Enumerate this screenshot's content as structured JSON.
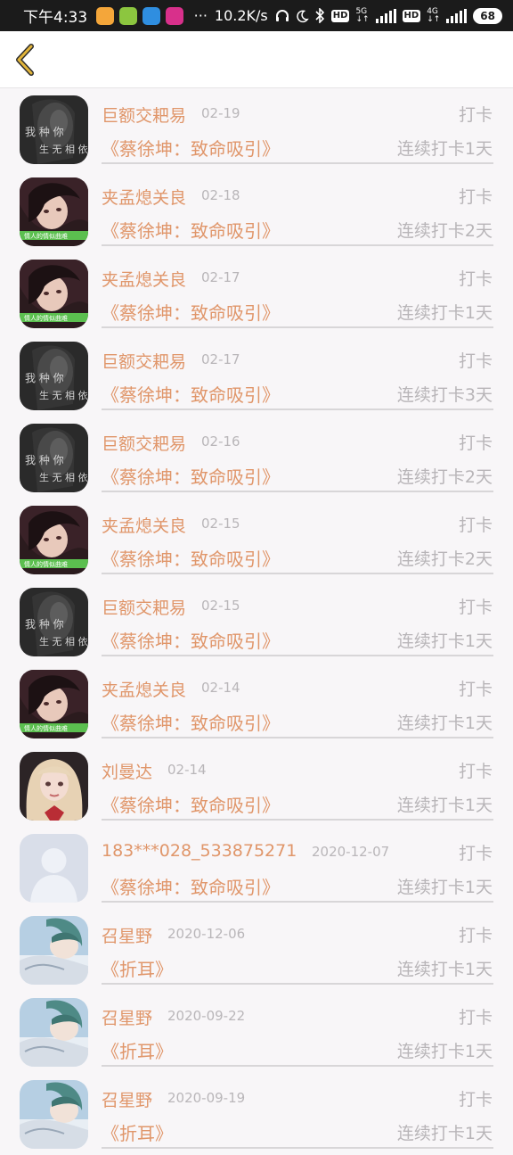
{
  "status_bar": {
    "time": "下午4:33",
    "more": "···",
    "speed": "10.2K/s",
    "hd1": "HD",
    "net1_top": "5G",
    "net1_bottom": "↓↑",
    "hd2": "HD",
    "net2_top": "4G",
    "net2_bottom": "↓↑",
    "battery": "68"
  },
  "nav": {
    "back_icon": "chevron-left-icon",
    "back_color": "#e2b53b"
  },
  "colors": {
    "accent": "#e0966a",
    "muted": "#b8b5b8"
  },
  "items": [
    {
      "name": "巨额交耙易",
      "date": "02-19",
      "action": "打卡",
      "book": "《蔡徐坤：致命吸引》",
      "streak": "连续打卡1天",
      "avatar": "dark-text-portrait"
    },
    {
      "name": "夹孟熄关良",
      "date": "02-18",
      "action": "打卡",
      "book": "《蔡徐坤：致命吸引》",
      "streak": "连续打卡2天",
      "avatar": "girl-portrait"
    },
    {
      "name": "夹孟熄关良",
      "date": "02-17",
      "action": "打卡",
      "book": "《蔡徐坤：致命吸引》",
      "streak": "连续打卡1天",
      "avatar": "girl-portrait"
    },
    {
      "name": "巨额交耙易",
      "date": "02-17",
      "action": "打卡",
      "book": "《蔡徐坤：致命吸引》",
      "streak": "连续打卡3天",
      "avatar": "dark-text-portrait"
    },
    {
      "name": "巨额交耙易",
      "date": "02-16",
      "action": "打卡",
      "book": "《蔡徐坤：致命吸引》",
      "streak": "连续打卡2天",
      "avatar": "dark-text-portrait"
    },
    {
      "name": "夹孟熄关良",
      "date": "02-15",
      "action": "打卡",
      "book": "《蔡徐坤：致命吸引》",
      "streak": "连续打卡2天",
      "avatar": "girl-portrait"
    },
    {
      "name": "巨额交耙易",
      "date": "02-15",
      "action": "打卡",
      "book": "《蔡徐坤：致命吸引》",
      "streak": "连续打卡1天",
      "avatar": "dark-text-portrait"
    },
    {
      "name": "夹孟熄关良",
      "date": "02-14",
      "action": "打卡",
      "book": "《蔡徐坤：致命吸引》",
      "streak": "连续打卡1天",
      "avatar": "girl-portrait"
    },
    {
      "name": "刘曼达",
      "date": "02-14",
      "action": "打卡",
      "book": "《蔡徐坤：致命吸引》",
      "streak": "连续打卡1天",
      "avatar": "blonde-girl-portrait"
    },
    {
      "name": "183***028_533875271",
      "date": "2020-12-07",
      "action": "打卡",
      "book": "《蔡徐坤：致命吸引》",
      "streak": "连续打卡1天",
      "avatar": "default-user-avatar"
    },
    {
      "name": "召星野",
      "date": "2020-12-06",
      "action": "打卡",
      "book": "《折耳》",
      "streak": "连续打卡1天",
      "avatar": "anime-portrait"
    },
    {
      "name": "召星野",
      "date": "2020-09-22",
      "action": "打卡",
      "book": "《折耳》",
      "streak": "连续打卡1天",
      "avatar": "anime-portrait"
    },
    {
      "name": "召星野",
      "date": "2020-09-19",
      "action": "打卡",
      "book": "《折耳》",
      "streak": "连续打卡1天",
      "avatar": "anime-portrait"
    }
  ]
}
